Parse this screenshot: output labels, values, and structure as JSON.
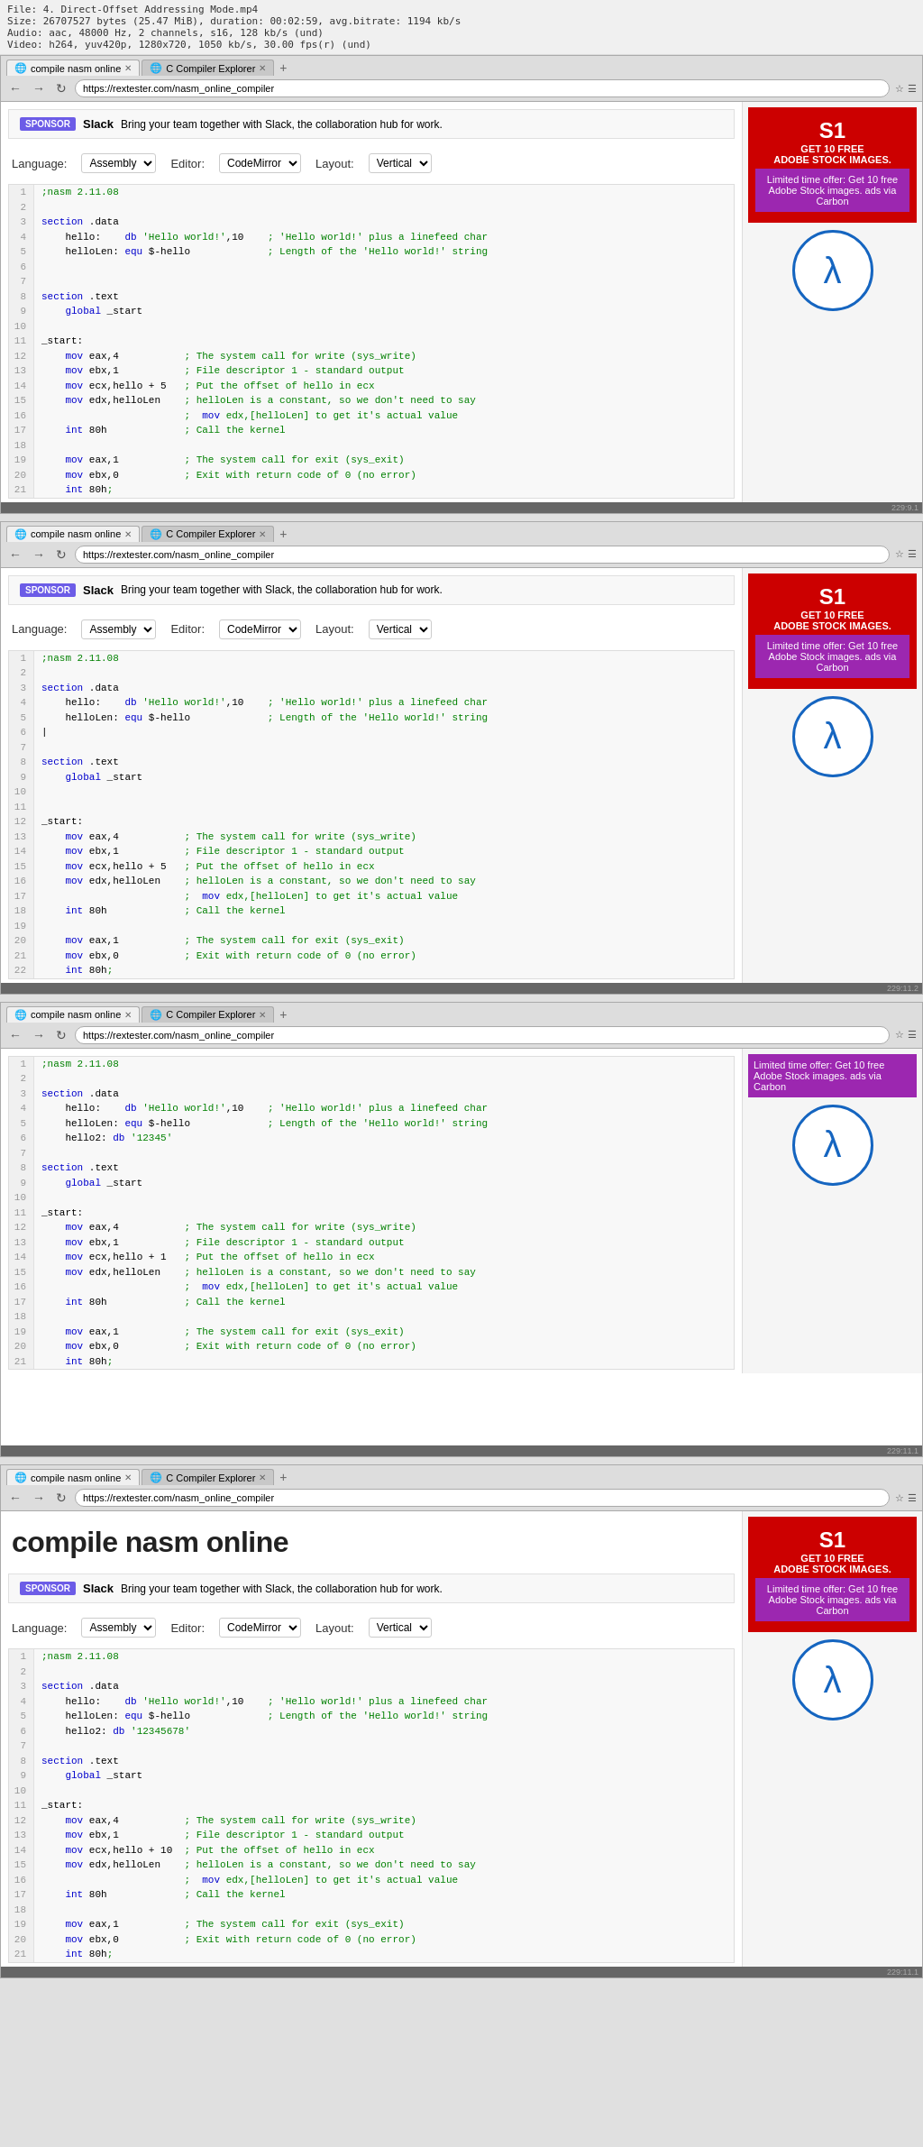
{
  "fileInfo": {
    "line1": "File: 4. Direct-Offset Addressing Mode.mp4",
    "line2": "Size: 26707527 bytes (25.47 MiB), duration: 00:02:59, avg.bitrate: 1194 kb/s",
    "line3": "Audio: aac, 48000 Hz, 2 channels, s16, 128 kb/s (und)",
    "line4": "Video: h264, yuv420p, 1280x720, 1050 kb/s, 30.00 fps(r) (und)"
  },
  "tabs": {
    "tab1": "compile nasm online",
    "tab2": "C Compiler Explorer",
    "new": "+"
  },
  "address": "https://rextester.com/nasm_online_compiler",
  "sponsor": {
    "badge": "SPONSOR",
    "brand": "Slack",
    "text": "Bring your team together with Slack, the collaboration hub for work."
  },
  "controls": {
    "languageLabel": "Language:",
    "languageValue": "Assembly",
    "editorLabel": "Editor:",
    "editorValue": "CodeMirror",
    "layoutLabel": "Layout:",
    "layoutValue": "Vertical"
  },
  "ad": {
    "line1": "GET 10 FREE",
    "line2": "ADOBE STOCK IMAGES.",
    "promo": "Limited time offer: Get 10 free Adobe Stock images. ads via Carbon"
  },
  "pageTitle": "compile nasm online",
  "snippets": [
    {
      "id": 1,
      "lines": [
        {
          "n": 1,
          "code": ";nasm 2.11.08",
          "type": "comment"
        },
        {
          "n": 2,
          "code": "",
          "type": "normal"
        },
        {
          "n": 3,
          "code": "section .data",
          "type": "normal"
        },
        {
          "n": 4,
          "code": "    hello:    db 'Hello world!',10    ; 'Hello world!' plus a linefeed char",
          "type": "normal"
        },
        {
          "n": 5,
          "code": "    helloLen: equ $-hello             ; Length of the 'Hello world!' string",
          "type": "normal"
        },
        {
          "n": 6,
          "code": "",
          "type": "normal"
        },
        {
          "n": 7,
          "code": "",
          "type": "normal"
        },
        {
          "n": 8,
          "code": "section .text",
          "type": "normal"
        },
        {
          "n": 9,
          "code": "    global _start",
          "type": "normal"
        },
        {
          "n": 10,
          "code": "",
          "type": "normal"
        },
        {
          "n": 11,
          "code": "_start:",
          "type": "normal"
        },
        {
          "n": 12,
          "code": "    mov eax,4           ; The system call for write (sys_write)",
          "type": "normal"
        },
        {
          "n": 13,
          "code": "    mov ebx,1           ; File descriptor 1 - standard output",
          "type": "normal"
        },
        {
          "n": 14,
          "code": "    mov ecx,hello + 5   ; Put the offset of hello in ecx",
          "type": "normal"
        },
        {
          "n": 15,
          "code": "    mov edx,helloLen    ; helloLen is a constant, so we don't need to say",
          "type": "normal"
        },
        {
          "n": 16,
          "code": "                        ;  mov edx,[helloLen] to get it's actual value",
          "type": "normal"
        },
        {
          "n": 17,
          "code": "    int 80h             ; Call the kernel",
          "type": "normal"
        },
        {
          "n": 18,
          "code": "",
          "type": "normal"
        },
        {
          "n": 19,
          "code": "    mov eax,1           ; The system call for exit (sys_exit)",
          "type": "normal"
        },
        {
          "n": 20,
          "code": "    mov ebx,0           ; Exit with return code of 0 (no error)",
          "type": "normal"
        },
        {
          "n": 21,
          "code": "    int 80h;",
          "type": "normal"
        }
      ]
    },
    {
      "id": 2,
      "lines": [
        {
          "n": 1,
          "code": ";nasm 2.11.08",
          "type": "comment"
        },
        {
          "n": 2,
          "code": "",
          "type": "normal"
        },
        {
          "n": 3,
          "code": "section .data",
          "type": "normal"
        },
        {
          "n": 4,
          "code": "    hello:    db 'Hello world!',10    ; 'Hello world!' plus a linefeed char",
          "type": "normal"
        },
        {
          "n": 5,
          "code": "    helloLen: equ $-hello             ; Length of the 'Hello world!' string",
          "type": "normal"
        },
        {
          "n": 6,
          "code": "|",
          "type": "normal"
        },
        {
          "n": 7,
          "code": "",
          "type": "normal"
        },
        {
          "n": 8,
          "code": "section .text",
          "type": "normal"
        },
        {
          "n": 9,
          "code": "    global _start",
          "type": "normal"
        },
        {
          "n": 10,
          "code": "",
          "type": "normal"
        },
        {
          "n": 11,
          "code": "",
          "type": "normal"
        },
        {
          "n": 12,
          "code": "_start:",
          "type": "normal"
        },
        {
          "n": 13,
          "code": "    mov eax,4           ; The system call for write (sys_write)",
          "type": "normal"
        },
        {
          "n": 14,
          "code": "    mov ebx,1           ; File descriptor 1 - standard output",
          "type": "normal"
        },
        {
          "n": 15,
          "code": "    mov ecx,hello + 5   ; Put the offset of hello in ecx",
          "type": "normal"
        },
        {
          "n": 16,
          "code": "    mov edx,helloLen    ; helloLen is a constant, so we don't need to say",
          "type": "normal"
        },
        {
          "n": 17,
          "code": "                        ;  mov edx,[helloLen] to get it's actual value",
          "type": "normal"
        },
        {
          "n": 18,
          "code": "    int 80h             ; Call the kernel",
          "type": "normal"
        },
        {
          "n": 19,
          "code": "",
          "type": "normal"
        },
        {
          "n": 20,
          "code": "    mov eax,1           ; The system call for exit (sys_exit)",
          "type": "normal"
        },
        {
          "n": 21,
          "code": "    mov ebx,0           ; Exit with return code of 0 (no error)",
          "type": "normal"
        },
        {
          "n": 22,
          "code": "    int 80h;",
          "type": "normal"
        }
      ]
    },
    {
      "id": 3,
      "lines": [
        {
          "n": 1,
          "code": ";nasm 2.11.08",
          "type": "comment"
        },
        {
          "n": 2,
          "code": "",
          "type": "normal"
        },
        {
          "n": 3,
          "code": "section .data",
          "type": "normal"
        },
        {
          "n": 4,
          "code": "    hello:    db 'Hello world!',10    ; 'Hello world!' plus a linefeed char",
          "type": "normal"
        },
        {
          "n": 5,
          "code": "    helloLen: equ $-hello             ; Length of the 'Hello world!' string",
          "type": "normal"
        },
        {
          "n": 6,
          "code": "    hello2: db '12345'",
          "type": "normal"
        },
        {
          "n": 7,
          "code": "",
          "type": "normal"
        },
        {
          "n": 8,
          "code": "section .text",
          "type": "normal"
        },
        {
          "n": 9,
          "code": "    global _start",
          "type": "normal"
        },
        {
          "n": 10,
          "code": "",
          "type": "normal"
        },
        {
          "n": 11,
          "code": "_start:",
          "type": "normal"
        },
        {
          "n": 12,
          "code": "    mov eax,4           ; The system call for write (sys_write)",
          "type": "normal"
        },
        {
          "n": 13,
          "code": "    mov ebx,1           ; File descriptor 1 - standard output",
          "type": "normal"
        },
        {
          "n": 14,
          "code": "    mov ecx,hello + 1   ; Put the offset of hello in ecx",
          "type": "normal"
        },
        {
          "n": 15,
          "code": "    mov edx,helloLen    ; helloLen is a constant, so we don't need to say",
          "type": "normal"
        },
        {
          "n": 16,
          "code": "                        ;  mov edx,[helloLen] to get it's actual value",
          "type": "normal"
        },
        {
          "n": 17,
          "code": "    int 80h             ; Call the kernel",
          "type": "normal"
        },
        {
          "n": 18,
          "code": "",
          "type": "normal"
        },
        {
          "n": 19,
          "code": "    mov eax,1           ; The system call for exit (sys_exit)",
          "type": "normal"
        },
        {
          "n": 20,
          "code": "    mov ebx,0           ; Exit with return code of 0 (no error)",
          "type": "normal"
        },
        {
          "n": 21,
          "code": "    int 80h;",
          "type": "normal"
        }
      ]
    },
    {
      "id": 4,
      "lines": [
        {
          "n": 1,
          "code": ";nasm 2.11.08",
          "type": "comment"
        },
        {
          "n": 2,
          "code": "",
          "type": "normal"
        },
        {
          "n": 3,
          "code": "section .data",
          "type": "normal"
        },
        {
          "n": 4,
          "code": "    hello:    db 'Hello world!',10    ; 'Hello world!' plus a linefeed char",
          "type": "normal"
        },
        {
          "n": 5,
          "code": "    helloLen: equ $-hello             ; Length of the 'Hello world!' string",
          "type": "normal"
        },
        {
          "n": 6,
          "code": "    hello2: db '12345678'",
          "type": "normal"
        },
        {
          "n": 7,
          "code": "",
          "type": "normal"
        },
        {
          "n": 8,
          "code": "section .text",
          "type": "normal"
        },
        {
          "n": 9,
          "code": "    global _start",
          "type": "normal"
        },
        {
          "n": 10,
          "code": "",
          "type": "normal"
        },
        {
          "n": 11,
          "code": "_start:",
          "type": "normal"
        },
        {
          "n": 12,
          "code": "    mov eax,4           ; The system call for write (sys_write)",
          "type": "normal"
        },
        {
          "n": 13,
          "code": "    mov ebx,1           ; File descriptor 1 - standard output",
          "type": "normal"
        },
        {
          "n": 14,
          "code": "    mov ecx,hello + 10  ; Put the offset of hello in ecx",
          "type": "normal"
        },
        {
          "n": 15,
          "code": "    mov edx,helloLen    ; helloLen is a constant, so we don't need to say",
          "type": "normal"
        },
        {
          "n": 16,
          "code": "                        ;  mov edx,[helloLen] to get it's actual value",
          "type": "normal"
        },
        {
          "n": 17,
          "code": "    int 80h             ; Call the kernel",
          "type": "normal"
        },
        {
          "n": 18,
          "code": "",
          "type": "normal"
        },
        {
          "n": 19,
          "code": "    mov eax,1           ; The system call for exit (sys_exit)",
          "type": "normal"
        },
        {
          "n": 20,
          "code": "    mov ebx,0           ; Exit with return code of 0 (no error)",
          "type": "normal"
        },
        {
          "n": 21,
          "code": "    int 80h;",
          "type": "normal"
        }
      ]
    }
  ],
  "timestamps": [
    "229:9.1",
    "229:11.2",
    "229:11.1",
    "229:11.1"
  ]
}
